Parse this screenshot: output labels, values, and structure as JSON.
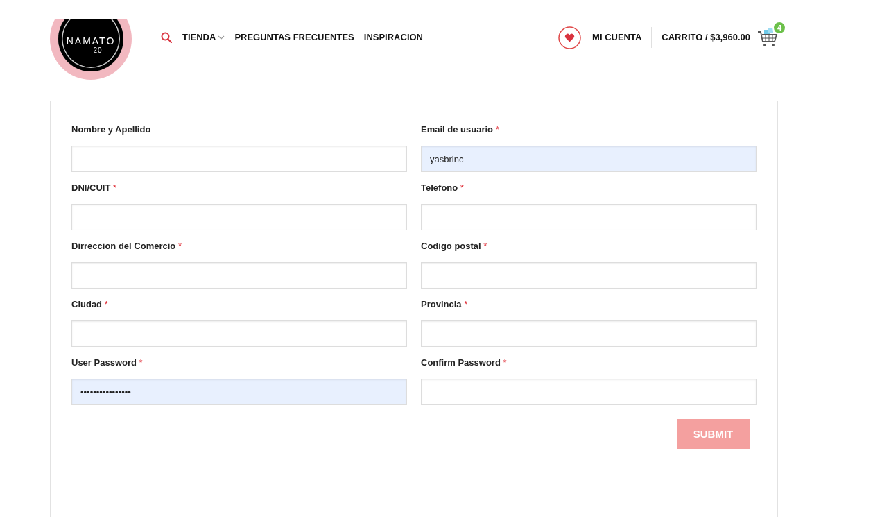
{
  "logo": {
    "name": "NAMATO",
    "number": "20"
  },
  "nav": [
    {
      "label": "TIENDA",
      "dropdown": true
    },
    {
      "label": "PREGUNTAS FRECUENTES",
      "dropdown": false
    },
    {
      "label": "INSPIRACION",
      "dropdown": false
    }
  ],
  "account": {
    "label": "MI CUENTA"
  },
  "cart": {
    "label": "CARRITO / $3,960.00",
    "count": "4"
  },
  "form": {
    "fields": [
      {
        "label": "Nombre y Apellido",
        "required": false,
        "autofilled": false
      },
      {
        "label": "Email de usuario",
        "required": true,
        "value": "yasbrinc",
        "autofilled": true
      },
      {
        "label": "DNI/CUIT",
        "required": true,
        "autofilled": false
      },
      {
        "label": "Telefono",
        "required": true,
        "autofilled": false
      },
      {
        "label": "Dirreccion del Comercio",
        "required": true,
        "autofilled": false
      },
      {
        "label": "Codigo postal",
        "required": true,
        "autofilled": false
      },
      {
        "label": "Ciudad",
        "required": true,
        "autofilled": false
      },
      {
        "label": "Provincia",
        "required": true,
        "autofilled": false
      },
      {
        "label": "User Password",
        "required": true,
        "value": "••••••••••••••••",
        "autofilled": true
      },
      {
        "label": "Confirm Password",
        "required": true,
        "autofilled": false
      }
    ],
    "required_mark": "*",
    "submit": "SUBMIT"
  }
}
